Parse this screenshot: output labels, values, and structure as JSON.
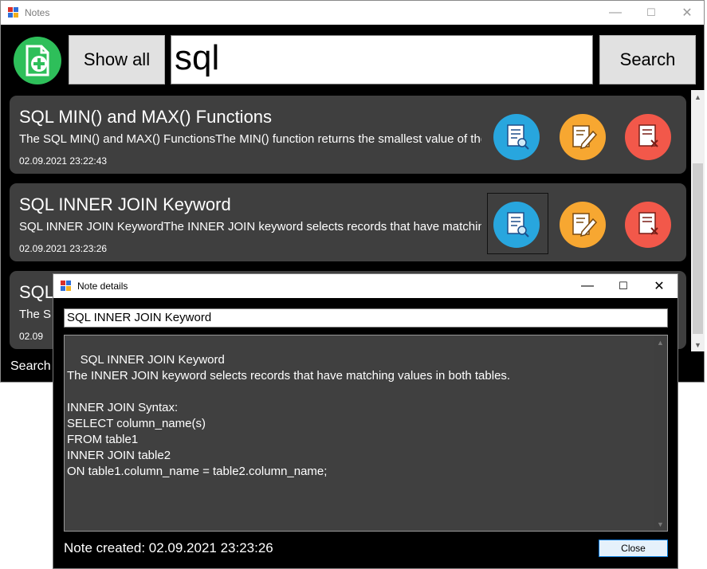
{
  "main_window": {
    "title": "Notes",
    "controls": [
      "—",
      "☐",
      "✕"
    ]
  },
  "toolbar": {
    "show_all_label": "Show all",
    "search_value": "sql",
    "search_label": "Search"
  },
  "notes": [
    {
      "title": "SQL MIN() and MAX() Functions",
      "body": "The SQL MIN() and MAX() FunctionsThe MIN() function returns the smallest value of the selected column.",
      "date": "02.09.2021 23:22:43"
    },
    {
      "title": "SQL INNER JOIN Keyword",
      "body": "SQL INNER JOIN KeywordThe INNER JOIN keyword selects records that have matching values in both tables.",
      "date": "02.09.2021 23:23:26"
    },
    {
      "title": "SQL",
      "body": "The S",
      "date": "02.09"
    }
  ],
  "status_label": "Search",
  "dialog": {
    "title": "Note details",
    "controls": [
      "—",
      "☐",
      "✕"
    ],
    "note_title": "SQL INNER JOIN Keyword",
    "note_body": "SQL INNER JOIN Keyword\nThe INNER JOIN keyword selects records that have matching values in both tables.\n\nINNER JOIN Syntax:\nSELECT column_name(s)\nFROM table1\nINNER JOIN table2\nON table1.column_name = table2.column_name;",
    "created": "Note created: 02.09.2021 23:23:26",
    "close_label": "Close"
  },
  "icons": {
    "add": "add-note-icon",
    "view": "view-note-icon",
    "edit": "edit-note-icon",
    "delete": "delete-note-icon"
  },
  "colors": {
    "add": "#2ebf5a",
    "view": "#28a6de",
    "edit": "#f7a731",
    "delete": "#f2584a",
    "card": "#3f3f3f"
  }
}
